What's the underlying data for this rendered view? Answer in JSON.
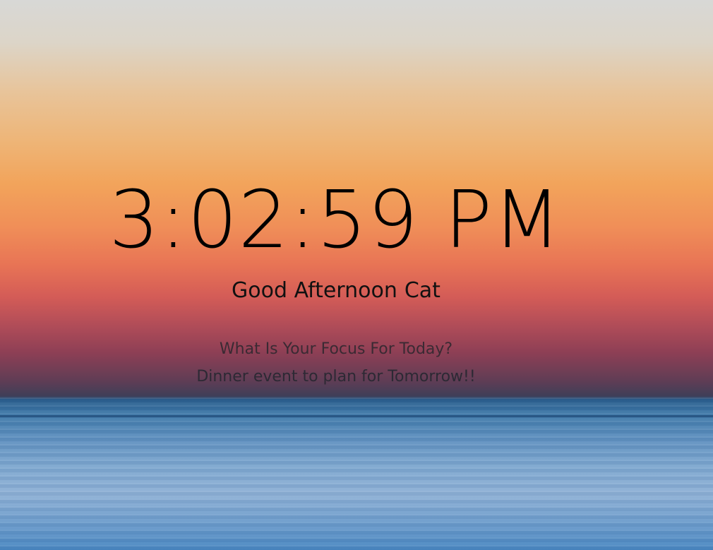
{
  "clock": {
    "time": "3:02:59 PM"
  },
  "greeting": {
    "prefix": "Good Afternoon",
    "name": "Cat"
  },
  "focus": {
    "question": "What Is Your Focus For Today?",
    "value": "Dinner event to plan for Tomorrow!!"
  },
  "background": {
    "description_icon": "sunset-sea-photo",
    "sky_top_color": "#d8d8d6",
    "sunset_color": "#f2a45b",
    "water_color": "#6e9dcc"
  }
}
